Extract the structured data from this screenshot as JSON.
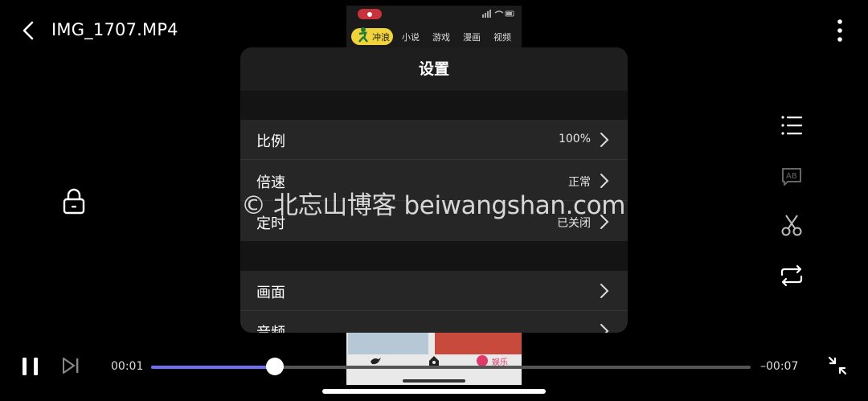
{
  "header": {
    "title": "IMG_1707.MP4"
  },
  "video_frame": {
    "tabs": [
      "冲浪",
      "小说",
      "游戏",
      "漫画",
      "视频"
    ],
    "bottom_tab_label": "娱乐"
  },
  "settings": {
    "title": "设置",
    "rows": [
      {
        "label": "比例",
        "value": "100%"
      },
      {
        "label": "倍速",
        "value": "正常"
      },
      {
        "label": "定时",
        "value": "已关闭"
      },
      {
        "label": "画面",
        "value": ""
      },
      {
        "label": "音频",
        "value": ""
      }
    ]
  },
  "watermark": "© 北忘山博客 beiwangshan.com",
  "player": {
    "current_time": "00:01",
    "remaining_time": "–00:07",
    "progress": 0.207,
    "accent_color": "#6f6ef0"
  },
  "icons": {
    "back": "chevron-left-icon",
    "more": "more-vertical-icon",
    "lock": "lock-icon",
    "playlist": "playlist-icon",
    "subtitle": "subtitle-ab-icon",
    "cut": "scissors-icon",
    "loop": "loop-icon",
    "pause": "pause-icon",
    "next": "skip-next-icon",
    "collapse": "collapse-icon"
  }
}
